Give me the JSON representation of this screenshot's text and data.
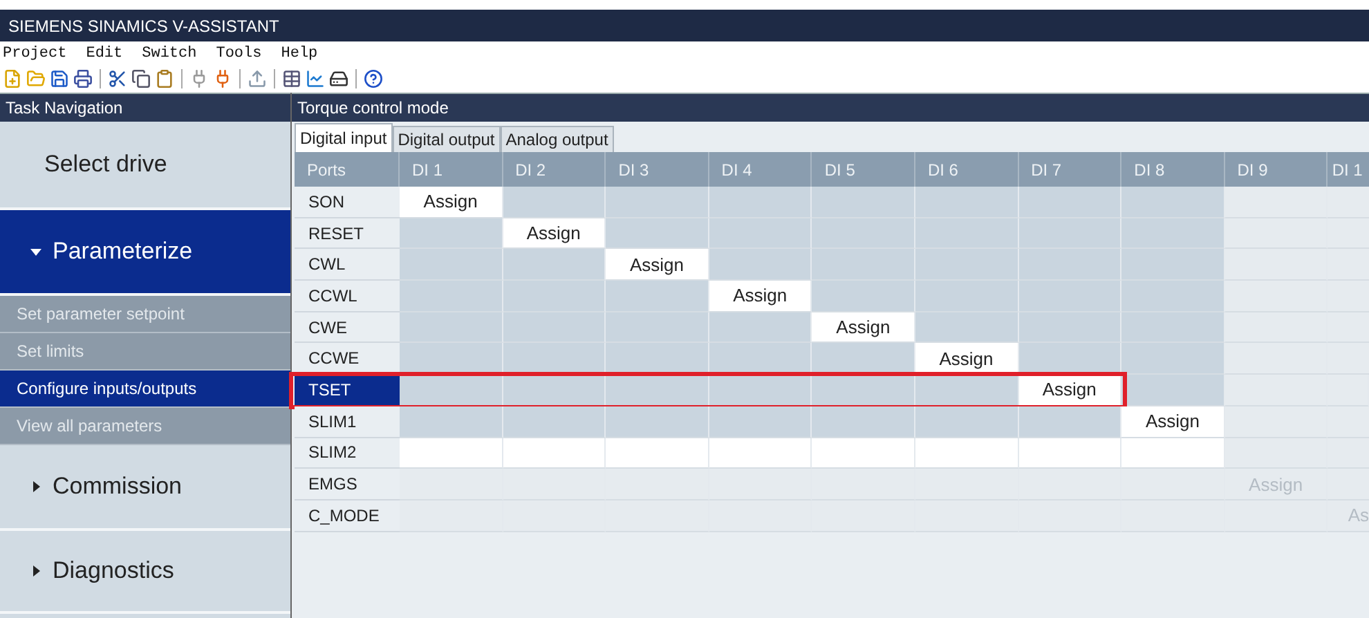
{
  "window": {
    "title": "SIEMENS SINAMICS V-ASSISTANT"
  },
  "menu": [
    "Project",
    "Edit",
    "Switch",
    "Tools",
    "Help"
  ],
  "sidebar": {
    "title": "Task Navigation",
    "items": [
      {
        "label": "Select drive",
        "kind": "plain",
        "selected": false
      },
      {
        "label": "Parameterize",
        "kind": "section",
        "selected": true,
        "expanded": true,
        "children": [
          {
            "label": "Set parameter setpoint",
            "selected": false
          },
          {
            "label": "Set limits",
            "selected": false
          },
          {
            "label": "Configure inputs/outputs",
            "selected": true
          },
          {
            "label": "View all parameters",
            "selected": false
          }
        ]
      },
      {
        "label": "Commission",
        "kind": "section",
        "selected": false,
        "expanded": false
      },
      {
        "label": "Diagnostics",
        "kind": "section",
        "selected": false,
        "expanded": false
      }
    ]
  },
  "main": {
    "title": "Torque control mode",
    "tabs": [
      {
        "label": "Digital input",
        "selected": true
      },
      {
        "label": "Digital output",
        "selected": false
      },
      {
        "label": "Analog output",
        "selected": false
      }
    ],
    "table": {
      "columns": [
        "Ports",
        "DI 1",
        "DI 2",
        "DI 3",
        "DI 4",
        "DI 5",
        "DI 6",
        "DI 7",
        "DI 8",
        "DI 9",
        "DI 1"
      ],
      "rows": [
        {
          "selected": false,
          "highlighted": false,
          "cells": [
            {
              "kind": "port",
              "text": "SON"
            },
            {
              "kind": "assign",
              "text": "Assign"
            },
            {
              "kind": "open"
            },
            {
              "kind": "open"
            },
            {
              "kind": "open"
            },
            {
              "kind": "open"
            },
            {
              "kind": "open"
            },
            {
              "kind": "open"
            },
            {
              "kind": "open"
            },
            {
              "kind": "unavailable"
            },
            {
              "kind": "unavailable"
            }
          ]
        },
        {
          "selected": false,
          "highlighted": false,
          "cells": [
            {
              "kind": "port",
              "text": "RESET"
            },
            {
              "kind": "open"
            },
            {
              "kind": "assign",
              "text": "Assign"
            },
            {
              "kind": "open"
            },
            {
              "kind": "open"
            },
            {
              "kind": "open"
            },
            {
              "kind": "open"
            },
            {
              "kind": "open"
            },
            {
              "kind": "open"
            },
            {
              "kind": "unavailable"
            },
            {
              "kind": "unavailable"
            }
          ]
        },
        {
          "selected": false,
          "highlighted": false,
          "cells": [
            {
              "kind": "port",
              "text": "CWL"
            },
            {
              "kind": "open"
            },
            {
              "kind": "open"
            },
            {
              "kind": "assign",
              "text": "Assign"
            },
            {
              "kind": "open"
            },
            {
              "kind": "open"
            },
            {
              "kind": "open"
            },
            {
              "kind": "open"
            },
            {
              "kind": "open"
            },
            {
              "kind": "unavailable"
            },
            {
              "kind": "unavailable"
            }
          ]
        },
        {
          "selected": false,
          "highlighted": false,
          "cells": [
            {
              "kind": "port",
              "text": "CCWL"
            },
            {
              "kind": "open"
            },
            {
              "kind": "open"
            },
            {
              "kind": "open"
            },
            {
              "kind": "assign",
              "text": "Assign"
            },
            {
              "kind": "open"
            },
            {
              "kind": "open"
            },
            {
              "kind": "open"
            },
            {
              "kind": "open"
            },
            {
              "kind": "unavailable"
            },
            {
              "kind": "unavailable"
            }
          ]
        },
        {
          "selected": false,
          "highlighted": false,
          "cells": [
            {
              "kind": "port",
              "text": "CWE"
            },
            {
              "kind": "open"
            },
            {
              "kind": "open"
            },
            {
              "kind": "open"
            },
            {
              "kind": "open"
            },
            {
              "kind": "assign",
              "text": "Assign"
            },
            {
              "kind": "open"
            },
            {
              "kind": "open"
            },
            {
              "kind": "open"
            },
            {
              "kind": "unavailable"
            },
            {
              "kind": "unavailable"
            }
          ]
        },
        {
          "selected": false,
          "highlighted": false,
          "cells": [
            {
              "kind": "port",
              "text": "CCWE"
            },
            {
              "kind": "open"
            },
            {
              "kind": "open"
            },
            {
              "kind": "open"
            },
            {
              "kind": "open"
            },
            {
              "kind": "open"
            },
            {
              "kind": "assign",
              "text": "Assign"
            },
            {
              "kind": "open"
            },
            {
              "kind": "open"
            },
            {
              "kind": "unavailable"
            },
            {
              "kind": "unavailable"
            }
          ]
        },
        {
          "selected": true,
          "highlighted": true,
          "cells": [
            {
              "kind": "port",
              "text": "TSET"
            },
            {
              "kind": "open"
            },
            {
              "kind": "open"
            },
            {
              "kind": "open"
            },
            {
              "kind": "open"
            },
            {
              "kind": "open"
            },
            {
              "kind": "open"
            },
            {
              "kind": "assign",
              "text": "Assign"
            },
            {
              "kind": "open"
            },
            {
              "kind": "unavailable"
            },
            {
              "kind": "unavailable"
            }
          ]
        },
        {
          "selected": false,
          "highlighted": false,
          "cells": [
            {
              "kind": "port",
              "text": "SLIM1"
            },
            {
              "kind": "open"
            },
            {
              "kind": "open"
            },
            {
              "kind": "open"
            },
            {
              "kind": "open"
            },
            {
              "kind": "open"
            },
            {
              "kind": "open"
            },
            {
              "kind": "open"
            },
            {
              "kind": "assign",
              "text": "Assign"
            },
            {
              "kind": "unavailable"
            },
            {
              "kind": "unavailable"
            }
          ]
        },
        {
          "selected": false,
          "highlighted": false,
          "cells": [
            {
              "kind": "port",
              "text": "SLIM2"
            },
            {
              "kind": "free"
            },
            {
              "kind": "free"
            },
            {
              "kind": "free"
            },
            {
              "kind": "free"
            },
            {
              "kind": "free"
            },
            {
              "kind": "free"
            },
            {
              "kind": "free"
            },
            {
              "kind": "free"
            },
            {
              "kind": "unavailable"
            },
            {
              "kind": "unavailable"
            }
          ]
        },
        {
          "selected": false,
          "highlighted": false,
          "cells": [
            {
              "kind": "port",
              "text": "EMGS"
            },
            {
              "kind": "unavailable"
            },
            {
              "kind": "unavailable"
            },
            {
              "kind": "unavailable"
            },
            {
              "kind": "unavailable"
            },
            {
              "kind": "unavailable"
            },
            {
              "kind": "unavailable"
            },
            {
              "kind": "unavailable"
            },
            {
              "kind": "unavailable"
            },
            {
              "kind": "assign-disabled",
              "text": "Assign"
            },
            {
              "kind": "unavailable"
            }
          ]
        },
        {
          "selected": false,
          "highlighted": false,
          "cells": [
            {
              "kind": "port",
              "text": "C_MODE"
            },
            {
              "kind": "unavailable"
            },
            {
              "kind": "unavailable"
            },
            {
              "kind": "unavailable"
            },
            {
              "kind": "unavailable"
            },
            {
              "kind": "unavailable"
            },
            {
              "kind": "unavailable"
            },
            {
              "kind": "unavailable"
            },
            {
              "kind": "unavailable"
            },
            {
              "kind": "unavailable"
            },
            {
              "kind": "assign-disabled",
              "text": "As"
            }
          ]
        }
      ]
    }
  }
}
